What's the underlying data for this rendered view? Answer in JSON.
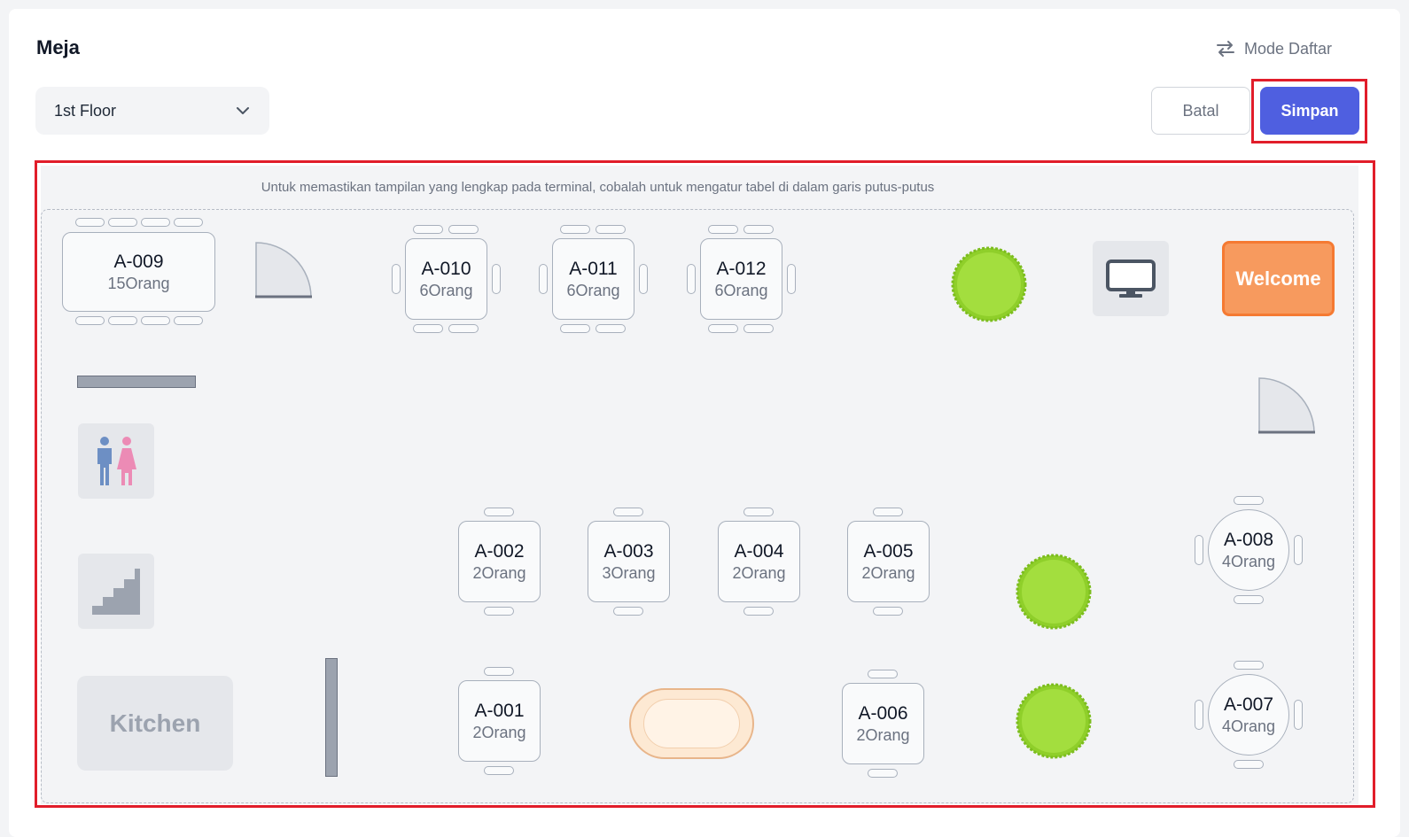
{
  "page": {
    "title": "Meja"
  },
  "header": {
    "mode_label": "Mode Daftar"
  },
  "toolbar": {
    "floor_selected": "1st Floor",
    "cancel_label": "Batal",
    "save_label": "Simpan"
  },
  "layout_editor": {
    "hint": "Untuk memastikan tampilan yang lengkap pada terminal, cobalah untuk mengatur tabel di dalam garis putus-putus",
    "tables": [
      {
        "name": "A-009",
        "capacity": "15Orang"
      },
      {
        "name": "A-010",
        "capacity": "6Orang"
      },
      {
        "name": "A-011",
        "capacity": "6Orang"
      },
      {
        "name": "A-012",
        "capacity": "6Orang"
      },
      {
        "name": "A-002",
        "capacity": "2Orang"
      },
      {
        "name": "A-003",
        "capacity": "3Orang"
      },
      {
        "name": "A-004",
        "capacity": "2Orang"
      },
      {
        "name": "A-005",
        "capacity": "2Orang"
      },
      {
        "name": "A-008",
        "capacity": "4Orang"
      },
      {
        "name": "A-001",
        "capacity": "2Orang"
      },
      {
        "name": "A-006",
        "capacity": "2Orang"
      },
      {
        "name": "A-007",
        "capacity": "4Orang"
      }
    ],
    "welcome_label": "Welcome",
    "kitchen_label": "Kitchen"
  },
  "colors": {
    "primary": "#4f5fe0",
    "highlight": "#e11d2a",
    "welcome": "#f79a5e",
    "plant": "#a3de3e"
  }
}
